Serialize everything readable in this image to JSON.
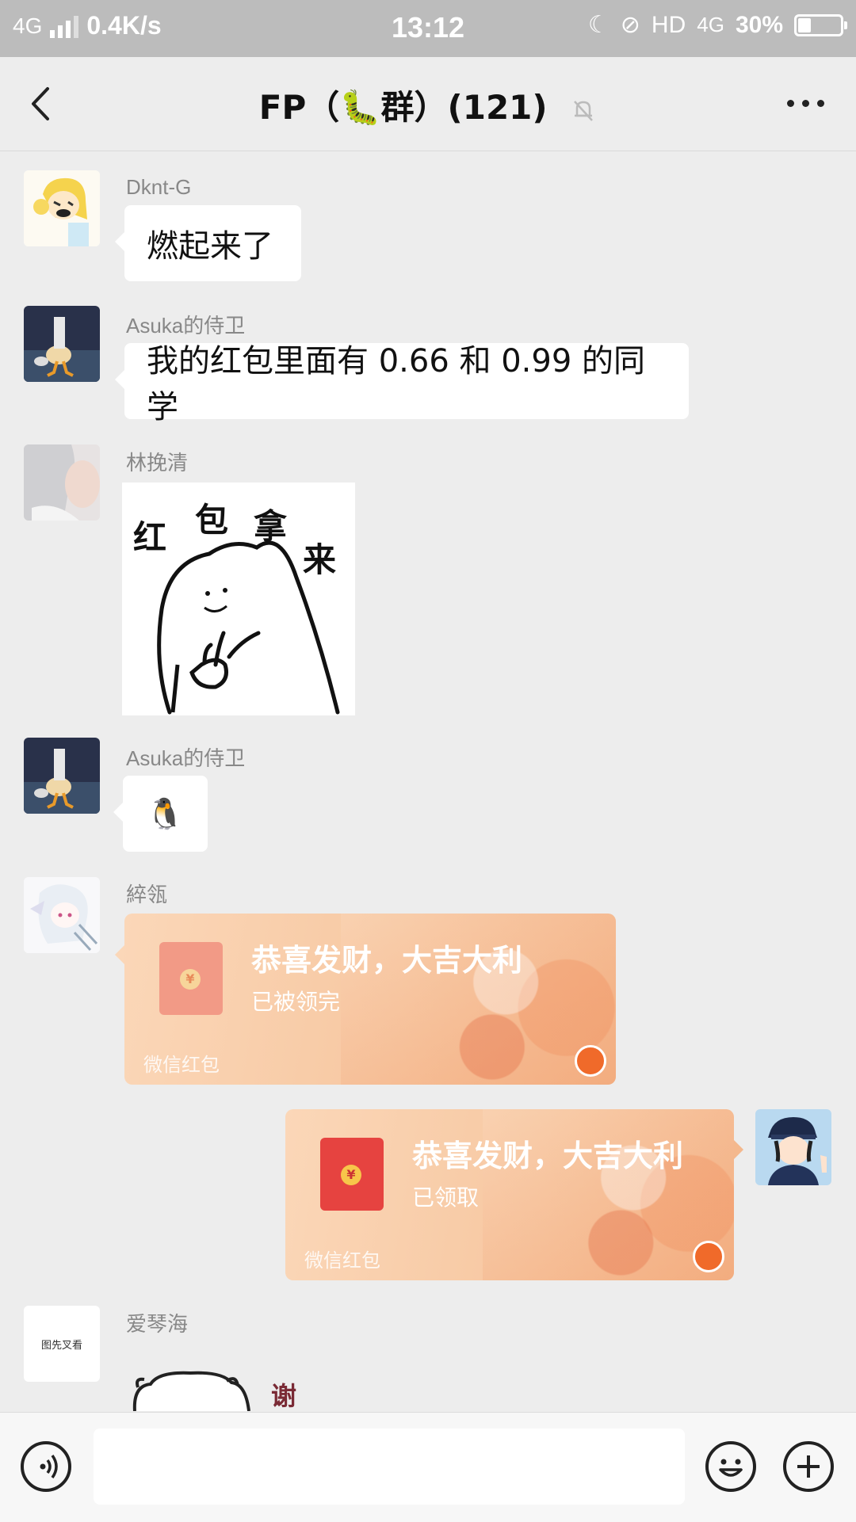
{
  "status_bar": {
    "network": "4G",
    "speed": "0.4K/s",
    "time": "13:12",
    "hd": "HD",
    "net2": "4G",
    "battery": "30%",
    "battery_level": 0.3
  },
  "navbar": {
    "title": "FP（🐛群）(121)"
  },
  "messages": [
    {
      "sender": "Dknt-G",
      "text": "燃起来了"
    },
    {
      "sender": "Asuka的侍卫",
      "text": "我的红包里面有 0.66 和 0.99 的同学"
    },
    {
      "sender": "林挽清",
      "sticker_text": [
        "红",
        "包",
        "拿",
        "来"
      ]
    },
    {
      "sender": "Asuka的侍卫",
      "emoji": "🐧"
    },
    {
      "sender": "綷瓴",
      "redpacket": {
        "title": "恭喜发财，大吉大利",
        "status": "已被领完",
        "footer": "微信红包"
      }
    },
    {
      "sender": "",
      "redpacket": {
        "title": "恭喜发财，大吉大利",
        "status": "已领取",
        "footer": "微信红包"
      }
    },
    {
      "sender": "爱琴海",
      "avatar_text": "图先叉看",
      "sticker_text": "谢"
    }
  ],
  "input": {
    "placeholder": ""
  },
  "colors": {
    "background": "#ededed",
    "status_bar": "#bcbcbc",
    "bubble": "#ffffff",
    "redpacket_opened": "#fbd7b8",
    "redpacket_envelope_faded": "#f29a86",
    "redpacket_envelope": "#e64340",
    "coin": "#f7c64a"
  },
  "icons": {
    "back": "chevron-left-icon",
    "mute": "bell-off-icon",
    "more": "more-dots-icon",
    "voice": "voice-icon",
    "emoji": "smiley-icon",
    "plus": "plus-icon"
  }
}
